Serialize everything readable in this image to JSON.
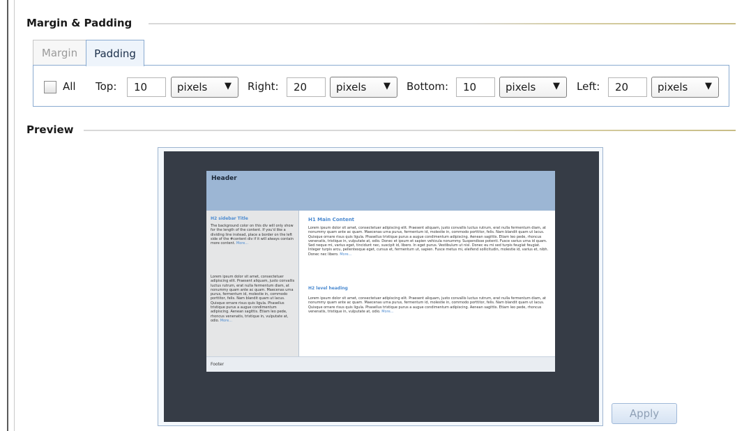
{
  "margin_padding": {
    "title": "Margin & Padding",
    "tabs": [
      {
        "label": "Margin",
        "active": false
      },
      {
        "label": "Padding",
        "active": true
      }
    ],
    "all_label": "All",
    "all_checked": false,
    "fields": [
      {
        "label": "Top:",
        "value": "10",
        "unit": "pixels"
      },
      {
        "label": "Right:",
        "value": "20",
        "unit": "pixels"
      },
      {
        "label": "Bottom:",
        "value": "10",
        "unit": "pixels"
      },
      {
        "label": "Left:",
        "value": "20",
        "unit": "pixels"
      }
    ],
    "dropdown_arrow": "▼"
  },
  "preview": {
    "title": "Preview",
    "site": {
      "header": "Header",
      "sidebar": {
        "title": "H2 sidebar Title",
        "p1": "The background color on this div will only show for the length of the content. If you'd like a dividing line instead, place a border on the left side of the #content div if it will always contain more content.",
        "p1_more": "More...",
        "p2": "Lorem ipsum dolor sit amet, consectetuer adipiscing elit. Praesent aliquam, justo convallis luctus rutrum, erat nulla fermentum diam, at nonummy quam ante ac quam. Maecenas urna purus, fermentum id, molestie in, commodo porttitor, felis. Nam blandit quam ut lacus. Quisque ornare risus quis ligula. Phasellus tristique purus a augue condimentum adipiscing. Aenean sagittis. Etiam leo pede, rhoncus venenatis, tristique in, vulputate at, odio.",
        "p2_more": "More..."
      },
      "main": {
        "h1": "H1 Main Content",
        "p1": "Lorem ipsum dolor sit amet, consectetuer adipiscing elit. Praesent aliquam, justo convallis luctus rutrum, erat nulla fermentum diam, at nonummy quam ante ac quam. Maecenas urna purus, fermentum id, molestie in, commodo porttitor, felis. Nam blandit quam ut lacus. Quisque ornare risus quis ligula. Phasellus tristique purus a augue condimentum adipiscing. Aenean sagittis. Etiam leo pede, rhoncus venenatis, tristique in, vulputate at, odio. Donec et ipsum et sapien vehicula nonummy. Suspendisse potenti. Fusce varius urna id quam. Sed neque mi, varius eget, tincidunt nec, suscipit id, libero. In eget purus. Vestibulum ut nisl. Donec eu mi sed turpis feugiat feugiat. Integer turpis arcu, pellentesque eget, cursus et, fermentum ut, sapien. Fusce metus mi, eleifend sollicitudin, molestie id, varius et, nibh. Donec nec libero.",
        "p1_more": "More...",
        "h2": "H2 level heading",
        "p2": "Lorem ipsum dolor sit amet, consectetuer adipiscing elit. Praesent aliquam, justo convallis luctus rutrum, erat nulla fermentum diam, at nonummy quam ante ac quam. Maecenas urna purus, fermentum id, molestie in, commodo porttitor, felis. Nam blandit quam ut lacus. Quisque ornare risus quis ligula. Phasellus tristique purus a augue condimentum adipiscing. Aenean sagittis. Etiam leo pede, rhoncus venenatis, tristique in, vulputate at, odio.",
        "p2_more": "More..."
      },
      "footer": "Footer"
    }
  },
  "apply_label": "Apply"
}
